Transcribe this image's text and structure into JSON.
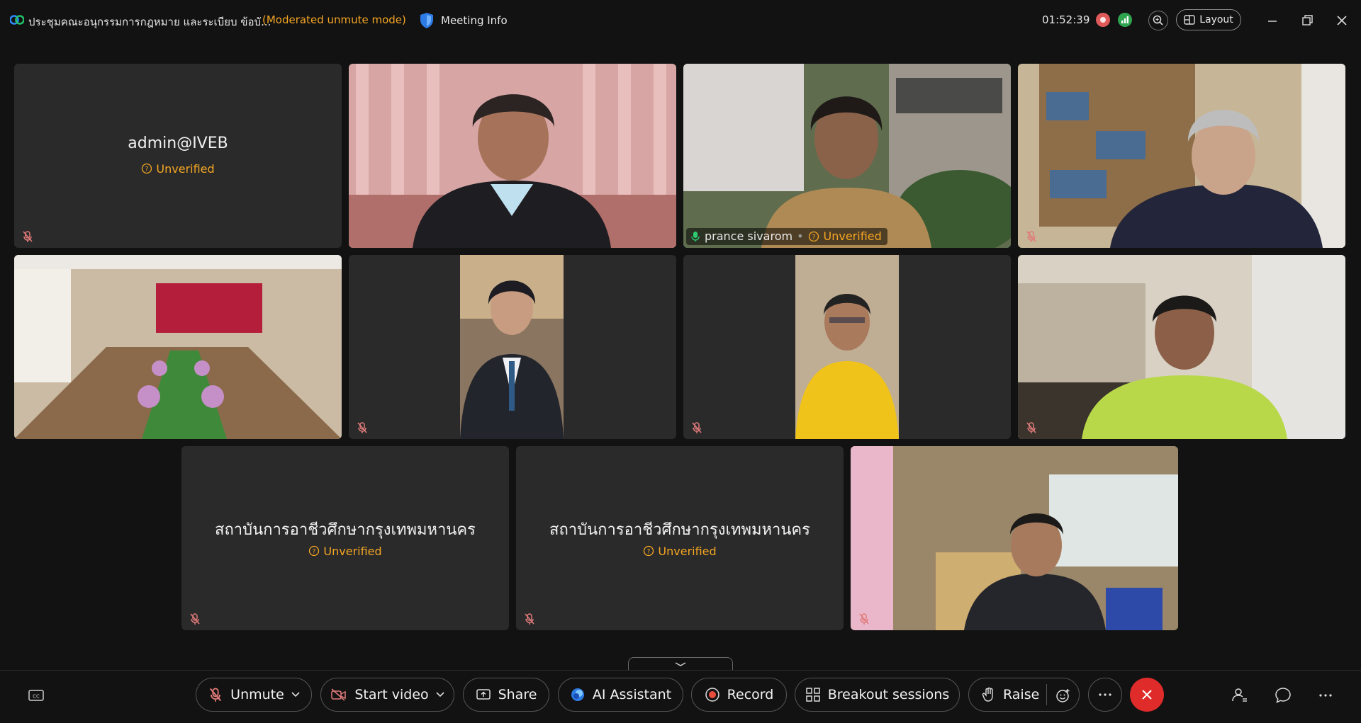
{
  "titlebar": {
    "meeting_title": "ประชุมคณะอนุกรรมการกฎหมาย และระเบียบ ข้อบั...",
    "mode": "(Moderated unmute mode)",
    "meeting_info_label": "Meeting Info",
    "timer": "01:52:39",
    "layout_label": "Layout"
  },
  "tiles": {
    "admin": {
      "name": "admin@IVEB",
      "status": "Unverified"
    },
    "prance": {
      "name": "prance sivarom",
      "status": "Unverified"
    },
    "inst1": {
      "name": "สถาบันการอาชีวศึกษากรุงเทพมหานคร",
      "status": "Unverified"
    },
    "inst2": {
      "name": "สถาบันการอาชีวศึกษากรุงเทพมหานคร",
      "status": "Unverified"
    }
  },
  "toolbar": {
    "unmute": "Unmute",
    "start_video": "Start video",
    "share": "Share",
    "ai_assistant": "AI Assistant",
    "record": "Record",
    "breakout": "Breakout sessions",
    "raise": "Raise"
  },
  "colors": {
    "accent_active": "#24a389",
    "warning": "#f5a623",
    "leave": "#e02b2b",
    "mute_icon": "#e07a7a"
  }
}
